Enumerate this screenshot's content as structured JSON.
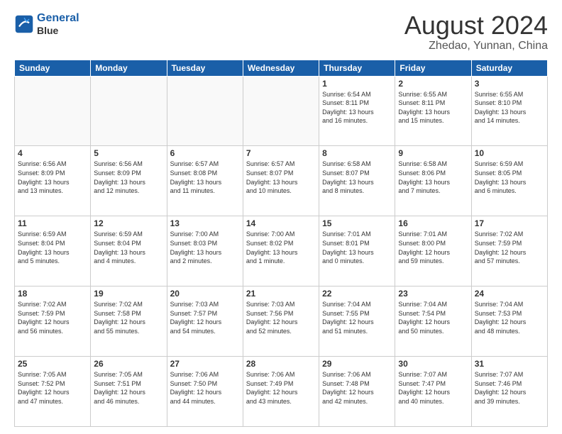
{
  "header": {
    "logo_line1": "General",
    "logo_line2": "Blue",
    "title": "August 2024",
    "subtitle": "Zhedao, Yunnan, China"
  },
  "days_of_week": [
    "Sunday",
    "Monday",
    "Tuesday",
    "Wednesday",
    "Thursday",
    "Friday",
    "Saturday"
  ],
  "weeks": [
    [
      {
        "day": "",
        "info": ""
      },
      {
        "day": "",
        "info": ""
      },
      {
        "day": "",
        "info": ""
      },
      {
        "day": "",
        "info": ""
      },
      {
        "day": "1",
        "info": "Sunrise: 6:54 AM\nSunset: 8:11 PM\nDaylight: 13 hours\nand 16 minutes."
      },
      {
        "day": "2",
        "info": "Sunrise: 6:55 AM\nSunset: 8:11 PM\nDaylight: 13 hours\nand 15 minutes."
      },
      {
        "day": "3",
        "info": "Sunrise: 6:55 AM\nSunset: 8:10 PM\nDaylight: 13 hours\nand 14 minutes."
      }
    ],
    [
      {
        "day": "4",
        "info": "Sunrise: 6:56 AM\nSunset: 8:09 PM\nDaylight: 13 hours\nand 13 minutes."
      },
      {
        "day": "5",
        "info": "Sunrise: 6:56 AM\nSunset: 8:09 PM\nDaylight: 13 hours\nand 12 minutes."
      },
      {
        "day": "6",
        "info": "Sunrise: 6:57 AM\nSunset: 8:08 PM\nDaylight: 13 hours\nand 11 minutes."
      },
      {
        "day": "7",
        "info": "Sunrise: 6:57 AM\nSunset: 8:07 PM\nDaylight: 13 hours\nand 10 minutes."
      },
      {
        "day": "8",
        "info": "Sunrise: 6:58 AM\nSunset: 8:07 PM\nDaylight: 13 hours\nand 8 minutes."
      },
      {
        "day": "9",
        "info": "Sunrise: 6:58 AM\nSunset: 8:06 PM\nDaylight: 13 hours\nand 7 minutes."
      },
      {
        "day": "10",
        "info": "Sunrise: 6:59 AM\nSunset: 8:05 PM\nDaylight: 13 hours\nand 6 minutes."
      }
    ],
    [
      {
        "day": "11",
        "info": "Sunrise: 6:59 AM\nSunset: 8:04 PM\nDaylight: 13 hours\nand 5 minutes."
      },
      {
        "day": "12",
        "info": "Sunrise: 6:59 AM\nSunset: 8:04 PM\nDaylight: 13 hours\nand 4 minutes."
      },
      {
        "day": "13",
        "info": "Sunrise: 7:00 AM\nSunset: 8:03 PM\nDaylight: 13 hours\nand 2 minutes."
      },
      {
        "day": "14",
        "info": "Sunrise: 7:00 AM\nSunset: 8:02 PM\nDaylight: 13 hours\nand 1 minute."
      },
      {
        "day": "15",
        "info": "Sunrise: 7:01 AM\nSunset: 8:01 PM\nDaylight: 13 hours\nand 0 minutes."
      },
      {
        "day": "16",
        "info": "Sunrise: 7:01 AM\nSunset: 8:00 PM\nDaylight: 12 hours\nand 59 minutes."
      },
      {
        "day": "17",
        "info": "Sunrise: 7:02 AM\nSunset: 7:59 PM\nDaylight: 12 hours\nand 57 minutes."
      }
    ],
    [
      {
        "day": "18",
        "info": "Sunrise: 7:02 AM\nSunset: 7:59 PM\nDaylight: 12 hours\nand 56 minutes."
      },
      {
        "day": "19",
        "info": "Sunrise: 7:02 AM\nSunset: 7:58 PM\nDaylight: 12 hours\nand 55 minutes."
      },
      {
        "day": "20",
        "info": "Sunrise: 7:03 AM\nSunset: 7:57 PM\nDaylight: 12 hours\nand 54 minutes."
      },
      {
        "day": "21",
        "info": "Sunrise: 7:03 AM\nSunset: 7:56 PM\nDaylight: 12 hours\nand 52 minutes."
      },
      {
        "day": "22",
        "info": "Sunrise: 7:04 AM\nSunset: 7:55 PM\nDaylight: 12 hours\nand 51 minutes."
      },
      {
        "day": "23",
        "info": "Sunrise: 7:04 AM\nSunset: 7:54 PM\nDaylight: 12 hours\nand 50 minutes."
      },
      {
        "day": "24",
        "info": "Sunrise: 7:04 AM\nSunset: 7:53 PM\nDaylight: 12 hours\nand 48 minutes."
      }
    ],
    [
      {
        "day": "25",
        "info": "Sunrise: 7:05 AM\nSunset: 7:52 PM\nDaylight: 12 hours\nand 47 minutes."
      },
      {
        "day": "26",
        "info": "Sunrise: 7:05 AM\nSunset: 7:51 PM\nDaylight: 12 hours\nand 46 minutes."
      },
      {
        "day": "27",
        "info": "Sunrise: 7:06 AM\nSunset: 7:50 PM\nDaylight: 12 hours\nand 44 minutes."
      },
      {
        "day": "28",
        "info": "Sunrise: 7:06 AM\nSunset: 7:49 PM\nDaylight: 12 hours\nand 43 minutes."
      },
      {
        "day": "29",
        "info": "Sunrise: 7:06 AM\nSunset: 7:48 PM\nDaylight: 12 hours\nand 42 minutes."
      },
      {
        "day": "30",
        "info": "Sunrise: 7:07 AM\nSunset: 7:47 PM\nDaylight: 12 hours\nand 40 minutes."
      },
      {
        "day": "31",
        "info": "Sunrise: 7:07 AM\nSunset: 7:46 PM\nDaylight: 12 hours\nand 39 minutes."
      }
    ]
  ]
}
